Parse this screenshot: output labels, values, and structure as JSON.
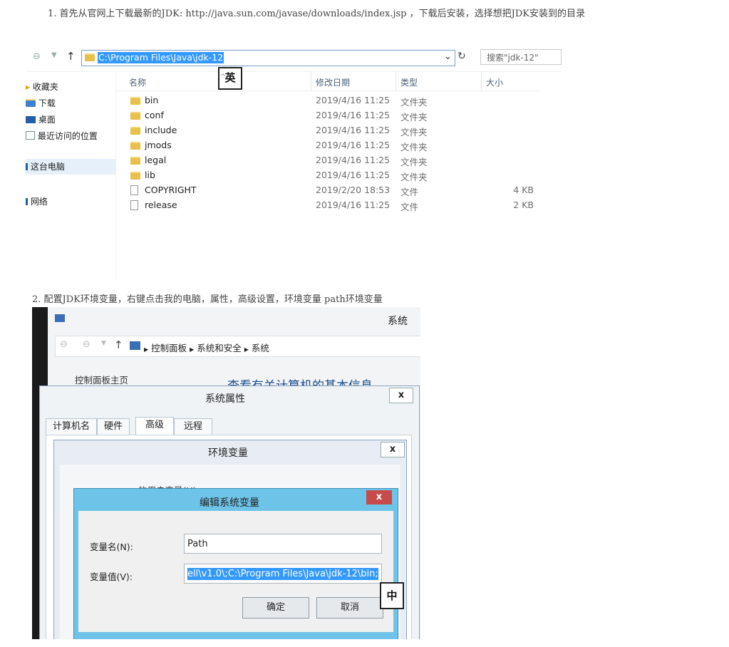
{
  "step1": {
    "num": "1.",
    "text": "首先从官网上下载最新的JDK: http://java.sun.com/javase/downloads/index.jsp ，下载后安装，选择想把JDK安装到的目录"
  },
  "explorer": {
    "address": "C:\\Program Files\\Java\\jdk-12",
    "search_placeholder": "搜索\"jdk-12\"",
    "refresh_glyph": "↻",
    "dropdown_glyph": "⌄",
    "up_glyph": "↑",
    "ime": "英",
    "sidebar": [
      {
        "label": "收藏夹",
        "icon": "star-icon"
      },
      {
        "label": "下载",
        "icon": "download-folder-icon"
      },
      {
        "label": "桌面",
        "icon": "desktop-icon"
      },
      {
        "label": "最近访问的位置",
        "icon": "recent-icon"
      },
      {
        "label": "这台电脑",
        "icon": "computer-icon"
      },
      {
        "label": "网络",
        "icon": "network-icon"
      }
    ],
    "columns": {
      "name": "名称",
      "date": "修改日期",
      "type": "类型",
      "size": "大小"
    },
    "files": [
      {
        "name": "bin",
        "date": "2019/4/16 11:25",
        "type": "文件夹",
        "size": "",
        "kind": "folder"
      },
      {
        "name": "conf",
        "date": "2019/4/16 11:25",
        "type": "文件夹",
        "size": "",
        "kind": "folder"
      },
      {
        "name": "include",
        "date": "2019/4/16 11:25",
        "type": "文件夹",
        "size": "",
        "kind": "folder"
      },
      {
        "name": "jmods",
        "date": "2019/4/16 11:25",
        "type": "文件夹",
        "size": "",
        "kind": "folder"
      },
      {
        "name": "legal",
        "date": "2019/4/16 11:25",
        "type": "文件夹",
        "size": "",
        "kind": "folder"
      },
      {
        "name": "lib",
        "date": "2019/4/16 11:25",
        "type": "文件夹",
        "size": "",
        "kind": "folder"
      },
      {
        "name": "COPYRIGHT",
        "date": "2019/2/20 18:53",
        "type": "文件",
        "size": "4 KB",
        "kind": "file"
      },
      {
        "name": "release",
        "date": "2019/4/16 11:25",
        "type": "文件",
        "size": "2 KB",
        "kind": "file"
      }
    ]
  },
  "step2": {
    "num": "2.",
    "text": "配置JDK环境变量，右键点击我的电脑，属性，高级设置，环境变量  path环境变量"
  },
  "system": {
    "window_title": "系统",
    "breadcrumb": [
      "控制面板",
      "系统和安全",
      "系统"
    ],
    "cp_home": "控制面板主页",
    "partial_heading": "查看有关计算机的基本信息",
    "sysprops_title": "系统属性",
    "tabs": [
      "计算机名",
      "硬件",
      "高级",
      "远程"
    ],
    "envvars_title": "环境变量",
    "partial_user_vars": "的用户变量(U)",
    "edit_title": "编辑系统变量",
    "var_name_label": "变量名(N):",
    "var_name_value": "Path",
    "var_value_label": "变量值(V):",
    "var_value_value": "ell\\v1.0\\;C:\\Program Files\\Java\\jdk-12\\bin;",
    "ok": "确定",
    "cancel": "取消",
    "close_glyph": "x",
    "ime": "中"
  }
}
